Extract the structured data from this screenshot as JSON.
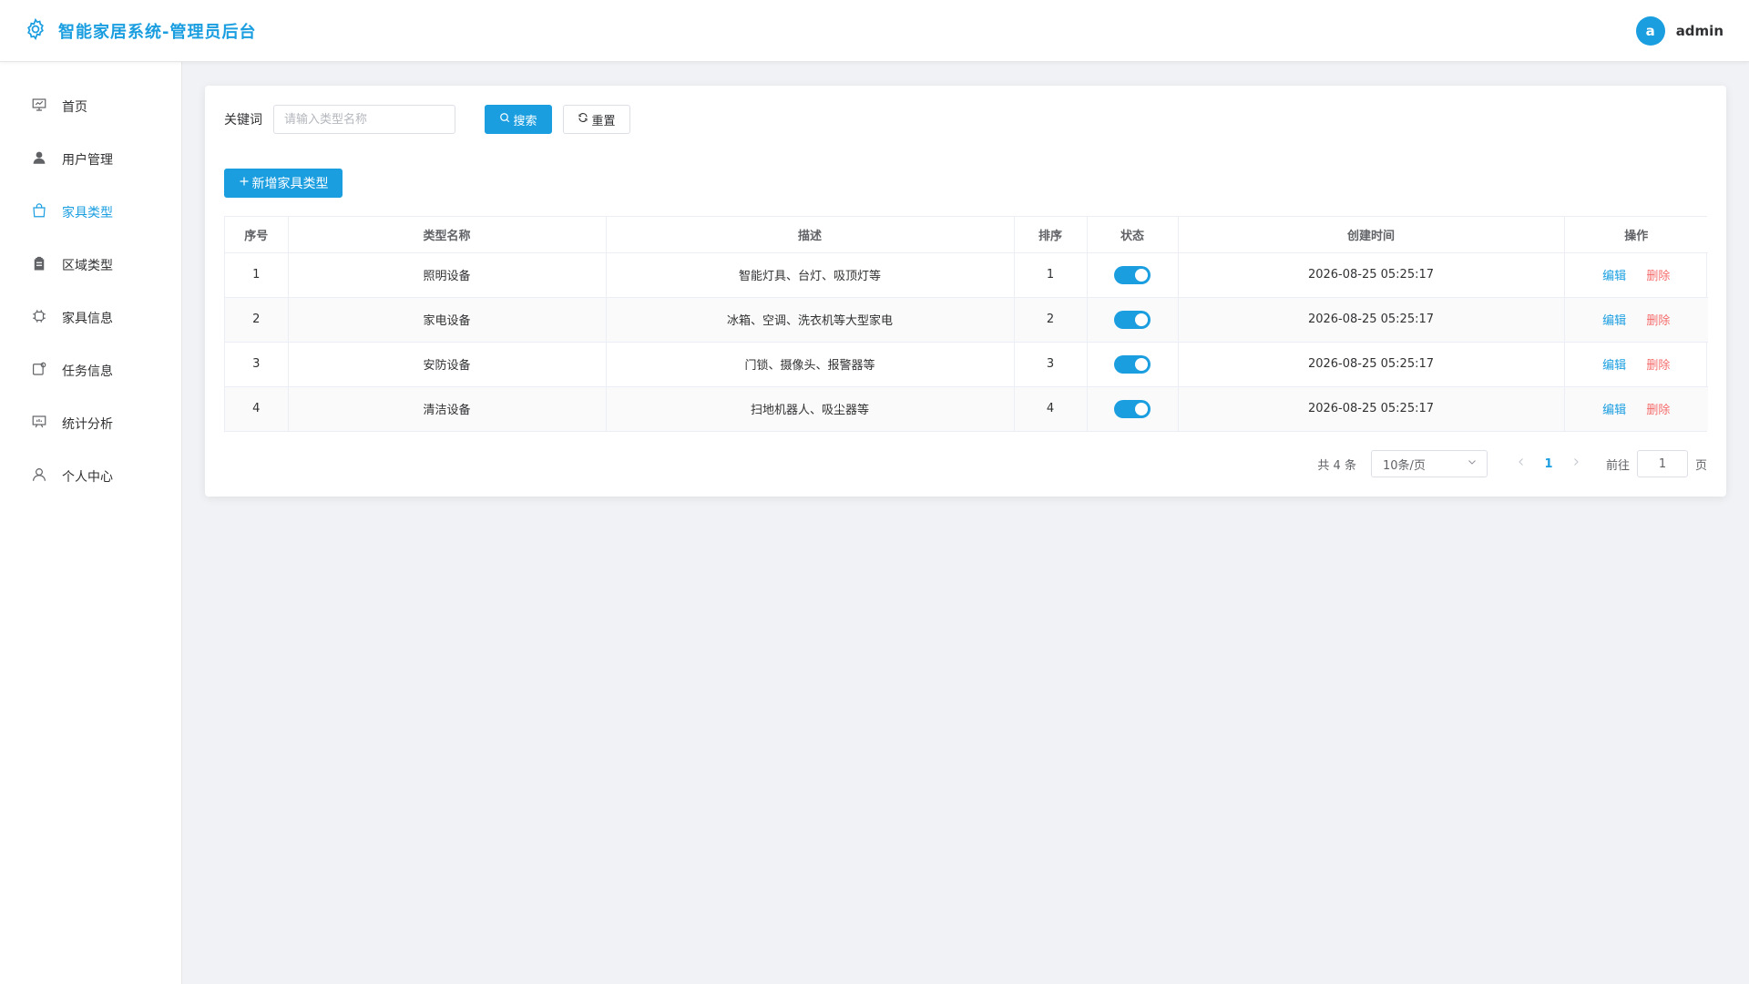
{
  "app": {
    "title": "智能家居系统-管理员后台",
    "accent_color": "#1a9ee0",
    "danger_color": "#f56c6c",
    "logo_icon": "gear-icon"
  },
  "user": {
    "avatar_letter": "a",
    "name": "admin"
  },
  "sidebar": {
    "items": [
      {
        "label": "首页",
        "icon": "presentation-icon",
        "active": false
      },
      {
        "label": "用户管理",
        "icon": "user-icon",
        "active": false
      },
      {
        "label": "家具类型",
        "icon": "bag-icon",
        "active": true
      },
      {
        "label": "区域类型",
        "icon": "clipboard-icon",
        "active": false
      },
      {
        "label": "家具信息",
        "icon": "chip-icon",
        "active": false
      },
      {
        "label": "任务信息",
        "icon": "task-icon",
        "active": false
      },
      {
        "label": "统计分析",
        "icon": "chart-board-icon",
        "active": false
      },
      {
        "label": "个人中心",
        "icon": "person-icon",
        "active": false
      }
    ]
  },
  "search": {
    "label": "关键词",
    "placeholder": "请输入类型名称",
    "value": "",
    "search_label": "搜索",
    "reset_label": "重置"
  },
  "toolbar": {
    "add_label": "新增家具类型"
  },
  "table": {
    "columns": [
      "序号",
      "类型名称",
      "描述",
      "排序",
      "状态",
      "创建时间",
      "操作"
    ],
    "rows": [
      {
        "index": "1",
        "name": "照明设备",
        "desc": "智能灯具、台灯、吸顶灯等",
        "sort": "1",
        "enabled": true,
        "created": "2026-08-25 05:25:17"
      },
      {
        "index": "2",
        "name": "家电设备",
        "desc": "冰箱、空调、洗衣机等大型家电",
        "sort": "2",
        "enabled": true,
        "created": "2026-08-25 05:25:17"
      },
      {
        "index": "3",
        "name": "安防设备",
        "desc": "门锁、摄像头、报警器等",
        "sort": "3",
        "enabled": true,
        "created": "2026-08-25 05:25:17"
      },
      {
        "index": "4",
        "name": "清洁设备",
        "desc": "扫地机器人、吸尘器等",
        "sort": "4",
        "enabled": true,
        "created": "2026-08-25 05:25:17"
      }
    ],
    "edit_label": "编辑",
    "delete_label": "删除"
  },
  "pagination": {
    "total_text": "共 4 条",
    "page_size": "10条/页",
    "current_page": "1",
    "goto_label": "前往",
    "goto_value": "1",
    "goto_suffix": "页"
  }
}
